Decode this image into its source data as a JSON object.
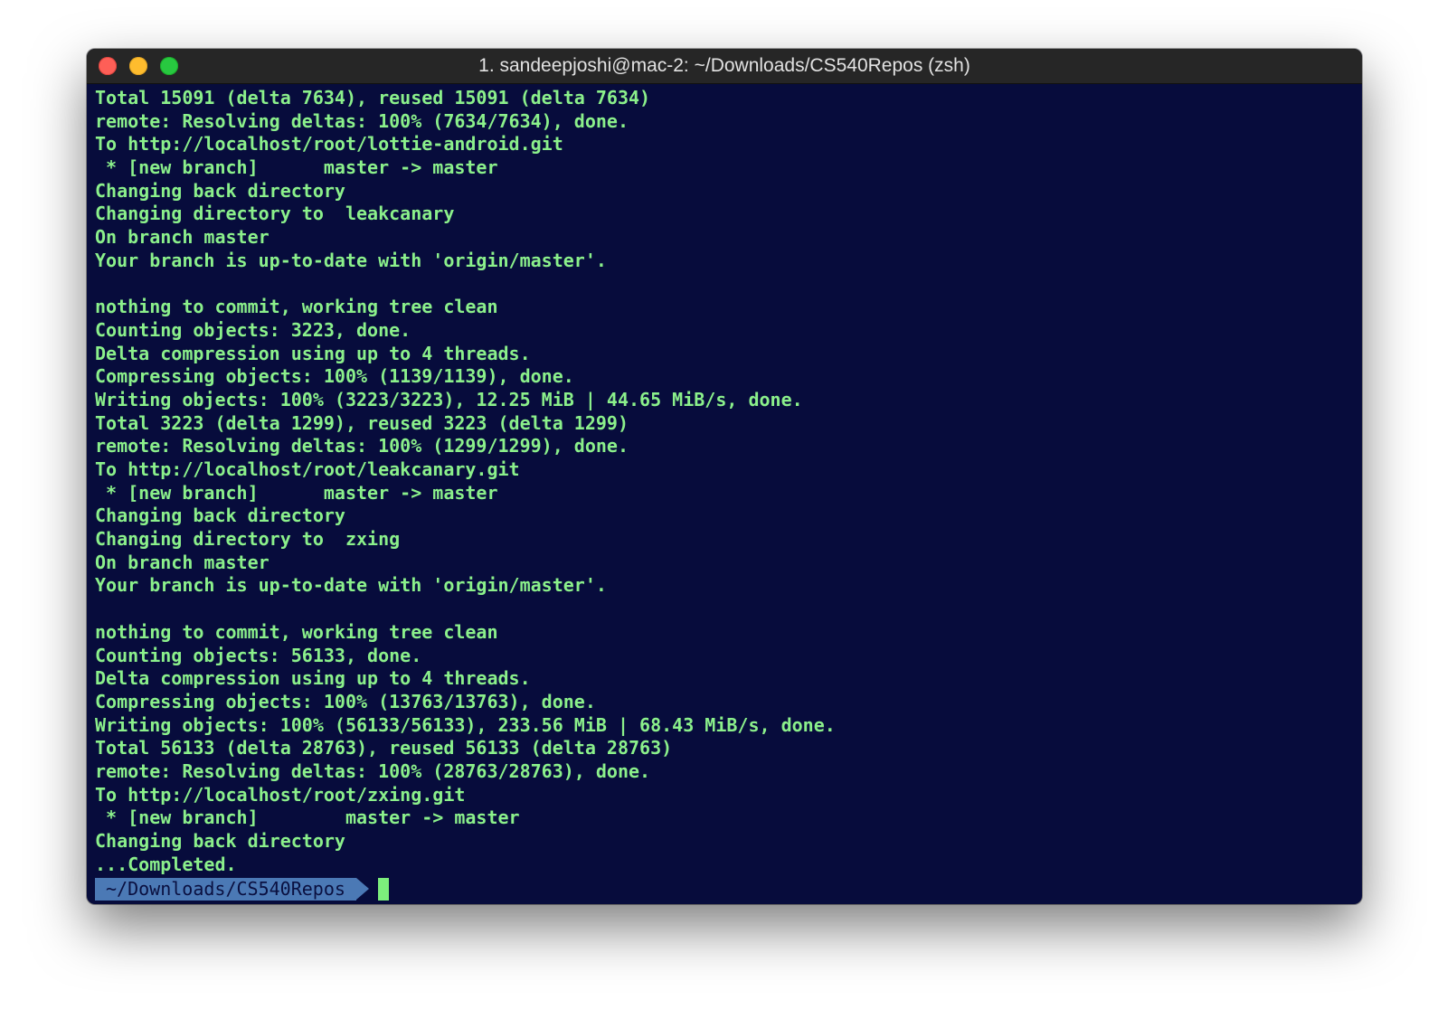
{
  "window": {
    "title": "1. sandeepjoshi@mac-2: ~/Downloads/CS540Repos (zsh)"
  },
  "colors": {
    "background": "#070c3c",
    "text": "#8bf08b",
    "prompt_bg": "#4b79b5",
    "titlebar": "#262626"
  },
  "terminal": {
    "lines": [
      "Total 15091 (delta 7634), reused 15091 (delta 7634)",
      "remote: Resolving deltas: 100% (7634/7634), done.",
      "To http://localhost/root/lottie-android.git",
      " * [new branch]      master -> master",
      "Changing back directory",
      "Changing directory to  leakcanary",
      "On branch master",
      "Your branch is up-to-date with 'origin/master'.",
      "",
      "nothing to commit, working tree clean",
      "Counting objects: 3223, done.",
      "Delta compression using up to 4 threads.",
      "Compressing objects: 100% (1139/1139), done.",
      "Writing objects: 100% (3223/3223), 12.25 MiB | 44.65 MiB/s, done.",
      "Total 3223 (delta 1299), reused 3223 (delta 1299)",
      "remote: Resolving deltas: 100% (1299/1299), done.",
      "To http://localhost/root/leakcanary.git",
      " * [new branch]      master -> master",
      "Changing back directory",
      "Changing directory to  zxing",
      "On branch master",
      "Your branch is up-to-date with 'origin/master'.",
      "",
      "nothing to commit, working tree clean",
      "Counting objects: 56133, done.",
      "Delta compression using up to 4 threads.",
      "Compressing objects: 100% (13763/13763), done.",
      "Writing objects: 100% (56133/56133), 233.56 MiB | 68.43 MiB/s, done.",
      "Total 56133 (delta 28763), reused 56133 (delta 28763)",
      "remote: Resolving deltas: 100% (28763/28763), done.",
      "To http://localhost/root/zxing.git",
      " * [new branch]        master -> master",
      "Changing back directory",
      "...Completed."
    ],
    "prompt_path": "~/Downloads/CS540Repos"
  }
}
